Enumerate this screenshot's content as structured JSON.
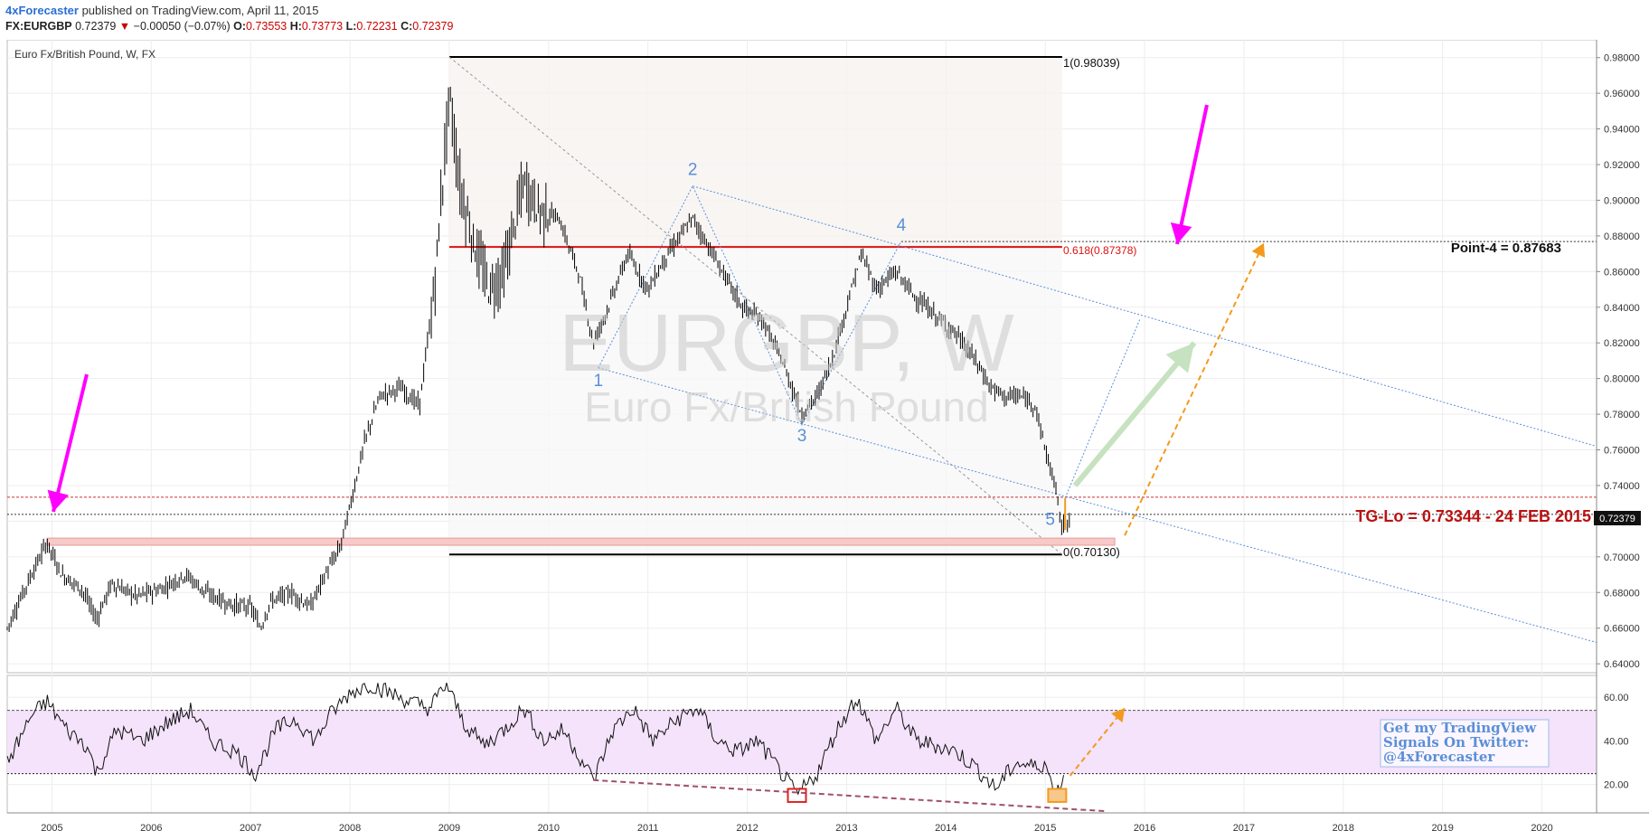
{
  "header": {
    "author": "4xForecaster",
    "published": "published on TradingView.com, April 11, 2015",
    "symbol": "FX:EURGBP",
    "last": "0.72379",
    "change_arrow": "▼",
    "change": "−0.00050 (−0.07%)",
    "o_label": "O:",
    "o": "0.73553",
    "h_label": "H:",
    "h": "0.73773",
    "l_label": "L:",
    "l": "0.72231",
    "c_label": "C:",
    "c": "0.72379"
  },
  "pane_title": "Euro Fx/British Pound, W, FX",
  "watermark": {
    "main": "EURGBP, W",
    "sub": "Euro Fx/British Pound"
  },
  "colors": {
    "price_line": "#000000",
    "fib": "#000000",
    "fib618": "#dd1111",
    "arrow": "#ff00ff",
    "wave": "#5b8fd8",
    "orange": "#f39a1e",
    "green": "#c6e2c0",
    "rsi_band": "#f4e3fb"
  },
  "chart_data": [
    {
      "type": "bar",
      "title": "Euro Fx/British Pound, W, FX",
      "series_desc": "weekly OHLC",
      "x_ticks": [
        "2005",
        "2006",
        "2007",
        "2008",
        "2009",
        "2010",
        "2011",
        "2012",
        "2013",
        "2014",
        "2015",
        "2016",
        "2017",
        "2018",
        "2019",
        "2020"
      ],
      "y_ticks": [
        "0.64000",
        "0.66000",
        "0.68000",
        "0.70000",
        "0.72000",
        "0.74000",
        "0.76000",
        "0.78000",
        "0.80000",
        "0.82000",
        "0.84000",
        "0.86000",
        "0.88000",
        "0.90000",
        "0.92000",
        "0.94000",
        "0.96000",
        "0.98000"
      ],
      "ylim": [
        0.635,
        0.99
      ],
      "xlim": [
        2004.55,
        2020.55
      ],
      "price_path": [
        [
          2004.55,
          0.66
        ],
        [
          2004.75,
          0.685
        ],
        [
          2004.95,
          0.708
        ],
        [
          2005.1,
          0.69
        ],
        [
          2005.3,
          0.682
        ],
        [
          2005.45,
          0.665
        ],
        [
          2005.6,
          0.685
        ],
        [
          2005.85,
          0.678
        ],
        [
          2006.1,
          0.682
        ],
        [
          2006.35,
          0.69
        ],
        [
          2006.55,
          0.68
        ],
        [
          2006.8,
          0.673
        ],
        [
          2007.0,
          0.672
        ],
        [
          2007.1,
          0.66
        ],
        [
          2007.2,
          0.675
        ],
        [
          2007.4,
          0.68
        ],
        [
          2007.6,
          0.672
        ],
        [
          2007.75,
          0.69
        ],
        [
          2007.9,
          0.705
        ],
        [
          2008.0,
          0.728
        ],
        [
          2008.15,
          0.765
        ],
        [
          2008.3,
          0.79
        ],
        [
          2008.5,
          0.795
        ],
        [
          2008.7,
          0.785
        ],
        [
          2008.85,
          0.85
        ],
        [
          2009.0,
          0.96
        ],
        [
          2009.1,
          0.91
        ],
        [
          2009.25,
          0.875
        ],
        [
          2009.4,
          0.85
        ],
        [
          2009.55,
          0.86
        ],
        [
          2009.75,
          0.91
        ],
        [
          2009.9,
          0.895
        ],
        [
          2010.1,
          0.89
        ],
        [
          2010.3,
          0.86
        ],
        [
          2010.45,
          0.82
        ],
        [
          2010.6,
          0.84
        ],
        [
          2010.8,
          0.87
        ],
        [
          2011.0,
          0.85
        ],
        [
          2011.2,
          0.87
        ],
        [
          2011.45,
          0.89
        ],
        [
          2011.6,
          0.875
        ],
        [
          2011.75,
          0.86
        ],
        [
          2011.95,
          0.84
        ],
        [
          2012.15,
          0.833
        ],
        [
          2012.35,
          0.81
        ],
        [
          2012.55,
          0.78
        ],
        [
          2012.7,
          0.79
        ],
        [
          2012.85,
          0.81
        ],
        [
          2013.0,
          0.84
        ],
        [
          2013.15,
          0.87
        ],
        [
          2013.3,
          0.85
        ],
        [
          2013.5,
          0.86
        ],
        [
          2013.7,
          0.845
        ],
        [
          2013.9,
          0.835
        ],
        [
          2014.1,
          0.825
        ],
        [
          2014.3,
          0.81
        ],
        [
          2014.45,
          0.795
        ],
        [
          2014.6,
          0.79
        ],
        [
          2014.75,
          0.79
        ],
        [
          2014.9,
          0.785
        ],
        [
          2015.0,
          0.76
        ],
        [
          2015.1,
          0.74
        ],
        [
          2015.17,
          0.715
        ],
        [
          2015.25,
          0.724
        ]
      ],
      "annotations": {
        "fib_1": "1(0.98039)",
        "fib_618": "0.618(0.87378)",
        "fib_0": "0(0.70130)",
        "point4": "Point-4 = 0.87683",
        "tg_lo": "TG-Lo = 0.73344 - 24 FEB 2015",
        "last_price": "0.72379",
        "waves": [
          {
            "label": "1",
            "x": 2010.5,
            "y": 0.805
          },
          {
            "label": "2",
            "x": 2011.45,
            "y": 0.908
          },
          {
            "label": "3",
            "x": 2012.55,
            "y": 0.774
          },
          {
            "label": "4",
            "x": 2013.55,
            "y": 0.877
          },
          {
            "label": "5",
            "x": 2015.05,
            "y": 0.727
          }
        ]
      }
    },
    {
      "type": "line",
      "series_desc": "RSI",
      "y_ticks": [
        "20.00",
        "40.00",
        "60.00"
      ],
      "ylim": [
        7,
        70
      ],
      "band": [
        25,
        54
      ],
      "rsi_path": [
        [
          2004.55,
          30
        ],
        [
          2004.8,
          52
        ],
        [
          2004.95,
          58
        ],
        [
          2005.15,
          45
        ],
        [
          2005.35,
          38
        ],
        [
          2005.45,
          25
        ],
        [
          2005.65,
          45
        ],
        [
          2005.9,
          40
        ],
        [
          2006.15,
          48
        ],
        [
          2006.4,
          54
        ],
        [
          2006.6,
          40
        ],
        [
          2006.85,
          35
        ],
        [
          2007.05,
          25
        ],
        [
          2007.25,
          45
        ],
        [
          2007.45,
          50
        ],
        [
          2007.65,
          40
        ],
        [
          2007.8,
          52
        ],
        [
          2008.0,
          62
        ],
        [
          2008.2,
          66
        ],
        [
          2008.4,
          62
        ],
        [
          2008.6,
          58
        ],
        [
          2008.8,
          55
        ],
        [
          2008.97,
          66
        ],
        [
          2009.15,
          48
        ],
        [
          2009.35,
          38
        ],
        [
          2009.55,
          45
        ],
        [
          2009.75,
          55
        ],
        [
          2009.95,
          40
        ],
        [
          2010.15,
          45
        ],
        [
          2010.35,
          30
        ],
        [
          2010.45,
          22
        ],
        [
          2010.65,
          45
        ],
        [
          2010.85,
          55
        ],
        [
          2011.05,
          40
        ],
        [
          2011.3,
          50
        ],
        [
          2011.5,
          55
        ],
        [
          2011.7,
          40
        ],
        [
          2011.9,
          35
        ],
        [
          2012.1,
          40
        ],
        [
          2012.3,
          28
        ],
        [
          2012.5,
          15
        ],
        [
          2012.7,
          25
        ],
        [
          2012.9,
          45
        ],
        [
          2013.1,
          60
        ],
        [
          2013.3,
          40
        ],
        [
          2013.5,
          55
        ],
        [
          2013.7,
          40
        ],
        [
          2013.9,
          38
        ],
        [
          2014.1,
          35
        ],
        [
          2014.3,
          28
        ],
        [
          2014.5,
          18
        ],
        [
          2014.7,
          30
        ],
        [
          2014.9,
          28
        ],
        [
          2015.0,
          30
        ],
        [
          2015.1,
          14
        ],
        [
          2015.2,
          26
        ]
      ]
    }
  ],
  "promo": {
    "line1": "Get my TradingView",
    "line2": "Signals On Twitter:",
    "line3": "@4xForecaster"
  }
}
